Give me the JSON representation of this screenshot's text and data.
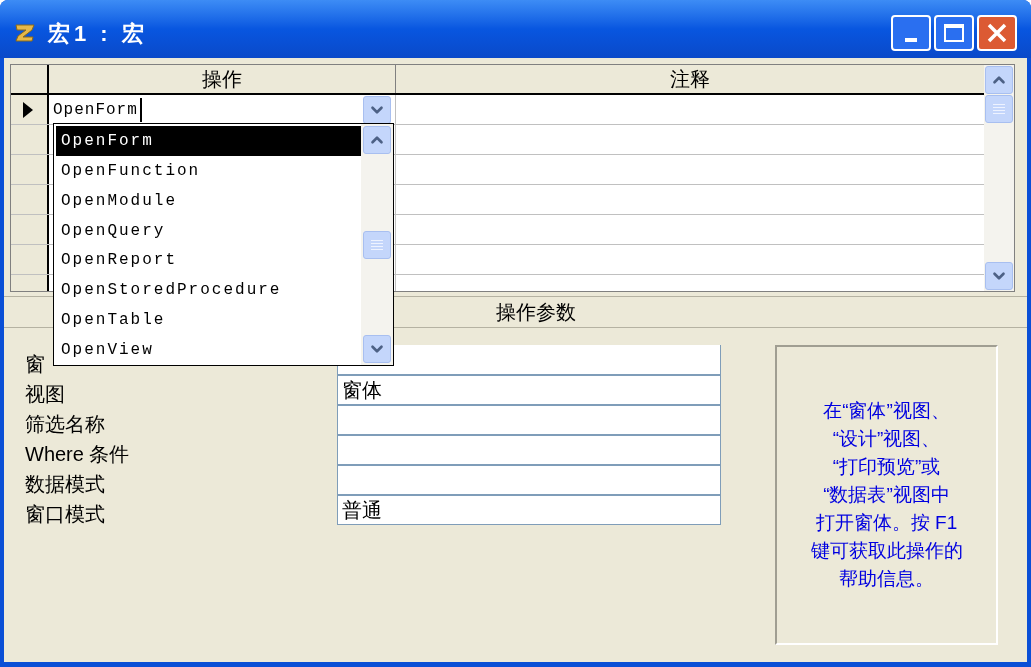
{
  "window": {
    "title": "宏1 : 宏"
  },
  "grid": {
    "columns": [
      "操作",
      "注释"
    ],
    "rows": [
      {
        "action": "OpenForm",
        "current": true
      }
    ]
  },
  "dropdown": {
    "items": [
      {
        "label": "OpenForm",
        "selected": true
      },
      {
        "label": "OpenFunction",
        "selected": false
      },
      {
        "label": "OpenModule",
        "selected": false
      },
      {
        "label": "OpenQuery",
        "selected": false
      },
      {
        "label": "OpenReport",
        "selected": false
      },
      {
        "label": "OpenStoredProcedure",
        "selected": false
      },
      {
        "label": "OpenTable",
        "selected": false
      },
      {
        "label": "OpenView",
        "selected": false
      }
    ]
  },
  "parameters": {
    "title": "操作参数",
    "fields": [
      {
        "label": "窗"
      },
      {
        "label": "视图",
        "value": "窗体"
      },
      {
        "label": "筛选名称"
      },
      {
        "label": "Where 条件"
      },
      {
        "label": "数据模式"
      },
      {
        "label": "窗口模式",
        "value": "普通"
      }
    ]
  },
  "help_lines": [
    "在“窗体”视图、",
    "“设计”视图、",
    "“打印预览”或",
    "“数据表”视图中",
    "打开窗体。按 F1",
    "键可获取此操作的",
    "帮助信息。"
  ]
}
